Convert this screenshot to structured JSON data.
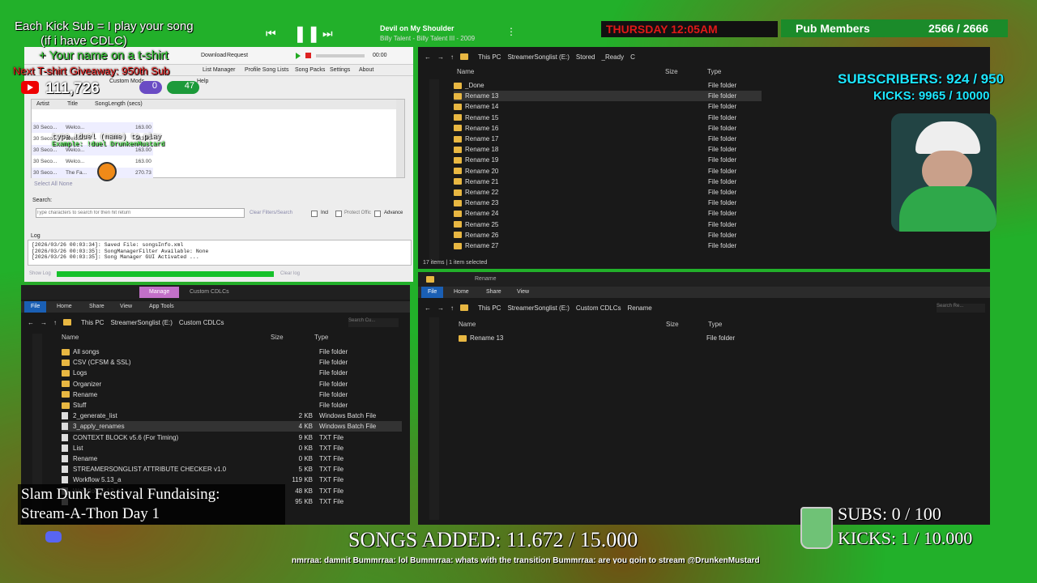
{
  "overlay": {
    "kick_sub_line1": "Each Kick Sub = I play your song",
    "kick_sub_line2": "(if i have CDLC)",
    "kick_sub_line3": "+ Your name on a t-shirt",
    "tshirt_giveaway": "Next T-shirt Giveaway: 950th Sub",
    "yt_count": "111,726",
    "track_title": "Devil on My Shoulder",
    "track_artist": "Billy Talent - Billy Talent III - 2009",
    "day_time": "THURSDAY 12:05AM",
    "pub_members_label": "Pub Members",
    "pub_members_count": "2566 / 2666",
    "subscribers": "SUBSCRIBERS: 924 / 950",
    "kicks": "KICKS: 9965 / 10000",
    "fundraising_line1": "Slam Dunk Festival Fundaising:",
    "fundraising_line2": "Stream-A-Thon Day 1",
    "songs_added": "SONGS ADDED: 11.672 / 15.000",
    "subs_goal": "SUBS:  0 / 100",
    "kicks_goal": "KICKS: 1 / 10.000",
    "chat_ticker": "nmrraa: damnit  Bummrraa: lol  Bummrraa: whats with the transition  Bummrraa: are you goin to stream @DrunkenMustard",
    "pill1": "0",
    "pill2": "47",
    "type_hint1": "type !duel (name) to play",
    "type_hint2": "Example: !duel DrunkenMustard"
  },
  "song_manager": {
    "tabs": [
      "Download",
      "Request"
    ],
    "time": "00:00",
    "menu": [
      "List Manager",
      "Profile Song Lists",
      "Song Packs",
      "Settings",
      "About"
    ],
    "subtabs": [
      "Custom Mods",
      "CDLC List",
      "Help"
    ],
    "columns": [
      "Artist",
      "Title",
      "SongLength (secs)"
    ],
    "rows": [
      {
        "artist": "30 Seco...",
        "title": "Welco...",
        "len": "163.00"
      },
      {
        "artist": "30 Seco...",
        "title": "Welco...",
        "len": "163.00"
      },
      {
        "artist": "30 Seco...",
        "title": "Welco...",
        "len": "163.00"
      },
      {
        "artist": "30 Seco...",
        "title": "Welco...",
        "len": "163.00"
      },
      {
        "artist": "30 Seco...",
        "title": "The Fa...",
        "len": "270.73"
      }
    ],
    "select_all": "Select All None",
    "search_label": "Search:",
    "search_placeholder": "Type characters to search for then hit return",
    "clear_filters": "Clear Filters/Search",
    "incl": "Incl",
    "protect": "Protect Offic",
    "advance": "Advance",
    "log_label": "Log",
    "log_lines": [
      "[2026/03/26 00:03:34]: Saved File: songsInfo.xml",
      "[2026/03/26 00:03:35]: SongManagerFilter Available: None",
      "[2026/03/26 00:03:35]: Song Manager GUI Activated ..."
    ],
    "show_log": "Show Log",
    "clear_log": "Clear log"
  },
  "explorer_top": {
    "breadcrumb": [
      "This PC",
      "StreamerSonglist (E:)",
      "Stored",
      "_Ready",
      "C"
    ],
    "col_name": "Name",
    "col_size": "Size",
    "col_type": "Type",
    "items": [
      "_Done",
      "Rename 13",
      "Rename 14",
      "Rename 15",
      "Rename 16",
      "Rename 17",
      "Rename 18",
      "Rename 19",
      "Rename 20",
      "Rename 21",
      "Rename 22",
      "Rename 23",
      "Rename 24",
      "Rename 25",
      "Rename 26",
      "Rename 27"
    ],
    "type": "File folder",
    "status": "17 items  |  1 item selected"
  },
  "explorer_bl": {
    "manage": "Manage",
    "title": "Custom CDLCs",
    "ribbon": [
      "File",
      "Home",
      "Share",
      "View",
      "App Tools"
    ],
    "breadcrumb": [
      "This PC",
      "StreamerSonglist (E:)",
      "Custom CDLCs"
    ],
    "search_placeholder": "Search Cu...",
    "col_name": "Name",
    "col_size": "Size",
    "col_type": "Type",
    "items": [
      {
        "name": "All songs",
        "size": "",
        "type": "File folder",
        "kind": "folder"
      },
      {
        "name": "CSV (CFSM & SSL)",
        "size": "",
        "type": "File folder",
        "kind": "folder"
      },
      {
        "name": "Logs",
        "size": "",
        "type": "File folder",
        "kind": "folder"
      },
      {
        "name": "Organizer",
        "size": "",
        "type": "File folder",
        "kind": "folder"
      },
      {
        "name": "Rename",
        "size": "",
        "type": "File folder",
        "kind": "folder"
      },
      {
        "name": "Stuff",
        "size": "",
        "type": "File folder",
        "kind": "folder"
      },
      {
        "name": "2_generate_list",
        "size": "2 KB",
        "type": "Windows Batch File",
        "kind": "file"
      },
      {
        "name": "3_apply_renames",
        "size": "4 KB",
        "type": "Windows Batch File",
        "kind": "file"
      },
      {
        "name": "CONTEXT BLOCK v5.6 (For Timing)",
        "size": "9 KB",
        "type": "TXT File",
        "kind": "file"
      },
      {
        "name": "List",
        "size": "0 KB",
        "type": "TXT File",
        "kind": "file"
      },
      {
        "name": "Rename",
        "size": "0 KB",
        "type": "TXT File",
        "kind": "file"
      },
      {
        "name": "STREAMERSONGLIST ATTRIBUTE CHECKER v1.0",
        "size": "5 KB",
        "type": "TXT File",
        "kind": "file"
      },
      {
        "name": "Workflow 5.13_a",
        "size": "119 KB",
        "type": "TXT File",
        "kind": "file"
      },
      {
        "name": "Workflow 5.13_b",
        "size": "48 KB",
        "type": "TXT File",
        "kind": "file"
      },
      {
        "name": "",
        "size": "95 KB",
        "type": "TXT File",
        "kind": "file"
      }
    ]
  },
  "explorer_br": {
    "title": "Rename",
    "ribbon": [
      "File",
      "Home",
      "Share",
      "View"
    ],
    "breadcrumb": [
      "This PC",
      "StreamerSonglist (E:)",
      "Custom CDLCs",
      "Rename"
    ],
    "search_placeholder": "Search Re...",
    "col_name": "Name",
    "col_size": "Size",
    "col_type": "Type",
    "items": [
      "Rename 13"
    ],
    "type": "File folder"
  }
}
